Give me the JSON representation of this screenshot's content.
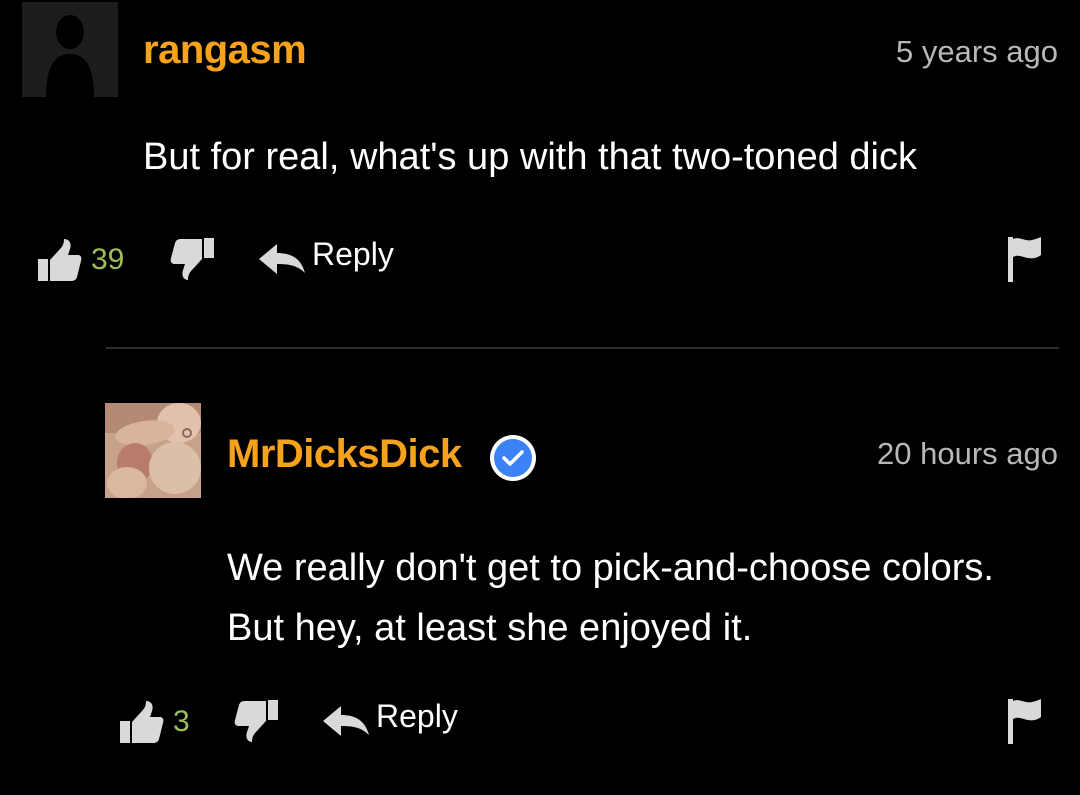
{
  "comments": [
    {
      "username": "rangasm",
      "timestamp": "5 years ago",
      "text": "But for real, what's up with that two-toned dick",
      "likes": "39",
      "reply_label": "Reply",
      "verified": false
    },
    {
      "username": "MrDicksDick",
      "timestamp": "20 hours ago",
      "text": "We really don't get to pick-and-choose colors. But hey, at least she enjoyed it.",
      "likes": "3",
      "reply_label": "Reply",
      "verified": true
    }
  ],
  "colors": {
    "background": "#000000",
    "username": "#f7a21b",
    "timestamp": "#b8b8b8",
    "like_count": "#9dbf5a",
    "icon_gray": "#d9d9d9",
    "verified_badge": "#3b82f6"
  },
  "icons": {
    "like": "thumbs-up-icon",
    "dislike": "thumbs-down-icon",
    "reply": "reply-arrow-icon",
    "flag": "flag-icon",
    "verified": "verified-check-icon"
  }
}
